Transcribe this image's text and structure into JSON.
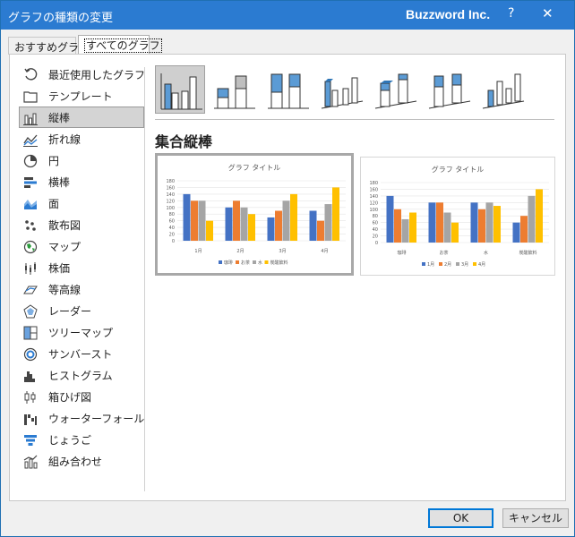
{
  "window": {
    "title": "グラフの種類の変更",
    "brand": "Buzzword Inc.",
    "help": "?",
    "close": "✕"
  },
  "tabs": [
    "おすすめグラフ",
    "すべてのグラフ"
  ],
  "sidebar": {
    "items": [
      {
        "label": "最近使用したグラフ",
        "icon": "recent-icon"
      },
      {
        "label": "テンプレート",
        "icon": "folder-icon"
      },
      {
        "label": "縦棒",
        "icon": "column-chart-icon"
      },
      {
        "label": "折れ線",
        "icon": "line-chart-icon"
      },
      {
        "label": "円",
        "icon": "pie-chart-icon"
      },
      {
        "label": "横棒",
        "icon": "bar-chart-icon"
      },
      {
        "label": "面",
        "icon": "area-chart-icon"
      },
      {
        "label": "散布図",
        "icon": "scatter-chart-icon"
      },
      {
        "label": "マップ",
        "icon": "map-chart-icon"
      },
      {
        "label": "株価",
        "icon": "stock-chart-icon"
      },
      {
        "label": "等高線",
        "icon": "surface-chart-icon"
      },
      {
        "label": "レーダー",
        "icon": "radar-chart-icon"
      },
      {
        "label": "ツリーマップ",
        "icon": "treemap-chart-icon"
      },
      {
        "label": "サンバースト",
        "icon": "sunburst-chart-icon"
      },
      {
        "label": "ヒストグラム",
        "icon": "histogram-chart-icon"
      },
      {
        "label": "箱ひげ図",
        "icon": "box-whisker-chart-icon"
      },
      {
        "label": "ウォーターフォール",
        "icon": "waterfall-chart-icon"
      },
      {
        "label": "じょうご",
        "icon": "funnel-chart-icon"
      },
      {
        "label": "組み合わせ",
        "icon": "combo-chart-icon"
      }
    ],
    "selected_index": 2
  },
  "section_title": "集合縦棒",
  "subtypes": [
    "clustered-column-icon",
    "stacked-column-icon",
    "100-stacked-column-icon",
    "3d-clustered-column-icon",
    "3d-stacked-column-icon",
    "3d-100-stacked-column-icon",
    "3d-column-icon"
  ],
  "colors": {
    "blue": "#4472c4",
    "orange": "#ed7d31",
    "gray": "#a5a5a5",
    "yellow": "#ffc000"
  },
  "previews": [
    {
      "title": "グラフ タイトル",
      "y_ticks": [
        "180",
        "160",
        "140",
        "120",
        "100",
        "80",
        "60",
        "40",
        "20",
        "0"
      ],
      "y_max": 180,
      "categories": [
        "1月",
        "2月",
        "3月",
        "4月"
      ],
      "series": [
        {
          "name": "珈琲",
          "values": [
            140,
            100,
            70,
            90
          ]
        },
        {
          "name": "お茶",
          "values": [
            120,
            120,
            90,
            60
          ]
        },
        {
          "name": "水",
          "values": [
            120,
            100,
            120,
            110
          ]
        },
        {
          "name": "炭酸飲料",
          "values": [
            60,
            80,
            140,
            160
          ]
        }
      ]
    },
    {
      "title": "グラフ タイトル",
      "y_ticks": [
        "180",
        "160",
        "140",
        "120",
        "100",
        "80",
        "60",
        "40",
        "20",
        "0"
      ],
      "y_max": 180,
      "categories": [
        "珈琲",
        "お茶",
        "水",
        "炭酸飲料"
      ],
      "series": [
        {
          "name": "1月",
          "values": [
            140,
            120,
            120,
            60
          ]
        },
        {
          "name": "2月",
          "values": [
            100,
            120,
            100,
            80
          ]
        },
        {
          "name": "3月",
          "values": [
            70,
            90,
            120,
            140
          ]
        },
        {
          "name": "4月",
          "values": [
            90,
            60,
            110,
            160
          ]
        }
      ]
    }
  ],
  "buttons": {
    "ok": "OK",
    "cancel": "キャンセル"
  }
}
